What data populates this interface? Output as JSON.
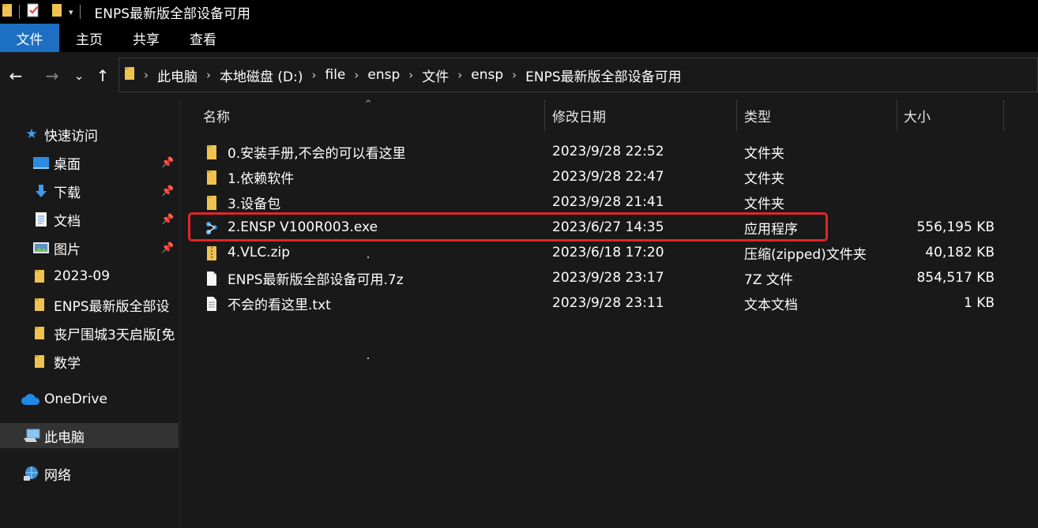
{
  "window": {
    "title": "ENPS最新版全部设备可用"
  },
  "ribbon": {
    "tabs": [
      "文件",
      "主页",
      "共享",
      "查看"
    ]
  },
  "address": {
    "crumbs": [
      "此电脑",
      "本地磁盘 (D:)",
      "file",
      "ensp",
      "文件",
      "ensp",
      "ENPS最新版全部设备可用"
    ]
  },
  "sidebar": {
    "quick_access": "快速访问",
    "items": [
      {
        "label": "桌面",
        "icon": "desktop-icon",
        "pinned": true
      },
      {
        "label": "下载",
        "icon": "download-icon",
        "pinned": true
      },
      {
        "label": "文档",
        "icon": "document-icon",
        "pinned": true
      },
      {
        "label": "图片",
        "icon": "pictures-icon",
        "pinned": true
      },
      {
        "label": "2023-09",
        "icon": "folder-icon",
        "pinned": false
      },
      {
        "label": "ENPS最新版全部设",
        "icon": "folder-icon",
        "pinned": false
      },
      {
        "label": "丧尸围城3天启版[免",
        "icon": "folder-icon",
        "pinned": false
      },
      {
        "label": "数学",
        "icon": "folder-icon",
        "pinned": false
      }
    ],
    "onedrive": "OneDrive",
    "this_pc": "此电脑",
    "network": "网络"
  },
  "columns": {
    "name": "名称",
    "modified": "修改日期",
    "type": "类型",
    "size": "大小"
  },
  "files": [
    {
      "name": "0.安装手册,不会的可以看这里",
      "modified": "2023/9/28 22:52",
      "type": "文件夹",
      "size": "",
      "icon": "folder-icon"
    },
    {
      "name": "1.依赖软件",
      "modified": "2023/9/28 22:47",
      "type": "文件夹",
      "size": "",
      "icon": "folder-icon"
    },
    {
      "name": "3.设备包",
      "modified": "2023/9/28 21:41",
      "type": "文件夹",
      "size": "",
      "icon": "folder-icon"
    },
    {
      "name": "2.ENSP V100R003.exe",
      "modified": "2023/6/27 14:35",
      "type": "应用程序",
      "size": "556,195 KB",
      "icon": "exe-icon"
    },
    {
      "name": "4.VLC.zip",
      "modified": "2023/6/18 17:20",
      "type": "压缩(zipped)文件夹",
      "size": "40,182 KB",
      "icon": "zip-folder-icon"
    },
    {
      "name": "ENPS最新版全部设备可用.7z",
      "modified": "2023/9/28 23:17",
      "type": "7Z 文件",
      "size": "854,517 KB",
      "icon": "file-icon"
    },
    {
      "name": "不会的看这里.txt",
      "modified": "2023/9/28 23:11",
      "type": "文本文档",
      "size": "1 KB",
      "icon": "text-file-icon"
    }
  ],
  "colors": {
    "accent": "#1c6fc2",
    "highlight": "#e3242b",
    "folder": "#f0c350"
  }
}
